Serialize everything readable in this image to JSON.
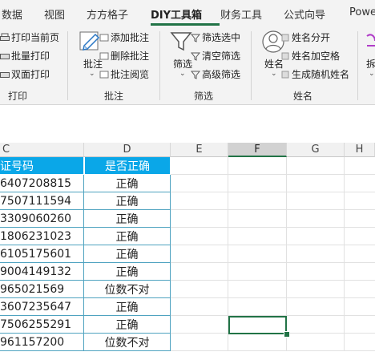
{
  "tabs": [
    {
      "label": "数据",
      "active": false
    },
    {
      "label": "视图",
      "active": false
    },
    {
      "label": "方方格子",
      "active": false
    },
    {
      "label": "DIY工具箱",
      "active": true
    },
    {
      "label": "财务工具",
      "active": false
    },
    {
      "label": "公式向导",
      "active": false
    },
    {
      "label": "Powe",
      "active": false
    }
  ],
  "ribbon": {
    "print_group": {
      "commands": [
        "打印当前页",
        "批量打印",
        "双面打印"
      ],
      "label": "打印"
    },
    "comment_group": {
      "big_button": "批注",
      "commands": [
        "添加批注",
        "删除批注",
        "批注阅览"
      ],
      "label": "批注"
    },
    "filter_group": {
      "big_button": "筛选",
      "commands": [
        "筛选选中",
        "清空筛选",
        "高级筛选"
      ],
      "label": "筛选"
    },
    "name_group": {
      "big_button": "姓名",
      "commands": [
        "姓名分开",
        "姓名加空格",
        "生成随机姓名"
      ],
      "label": "姓名"
    },
    "partial_big_button": "拆"
  },
  "grid": {
    "columns": [
      "C",
      "D",
      "E",
      "F",
      "G",
      "H"
    ],
    "selected_column": "F",
    "header_row": {
      "c": "证号码",
      "d": "是否正确"
    },
    "rows": [
      {
        "c": "6407208815",
        "d": "正确"
      },
      {
        "c": "7507111594",
        "d": "正确"
      },
      {
        "c": "3309060260",
        "d": "正确"
      },
      {
        "c": "1806231023",
        "d": "正确"
      },
      {
        "c": "6105175601",
        "d": "正确"
      },
      {
        "c": "9004149132",
        "d": "正确"
      },
      {
        "c": "965021569",
        "d": "位数不对"
      },
      {
        "c": "3607235647",
        "d": "正确"
      },
      {
        "c": "7506255291",
        "d": "正确"
      },
      {
        "c": "961157200",
        "d": "位数不对"
      }
    ],
    "header_color": "#0aa7e8",
    "selection_color": "#217346"
  }
}
